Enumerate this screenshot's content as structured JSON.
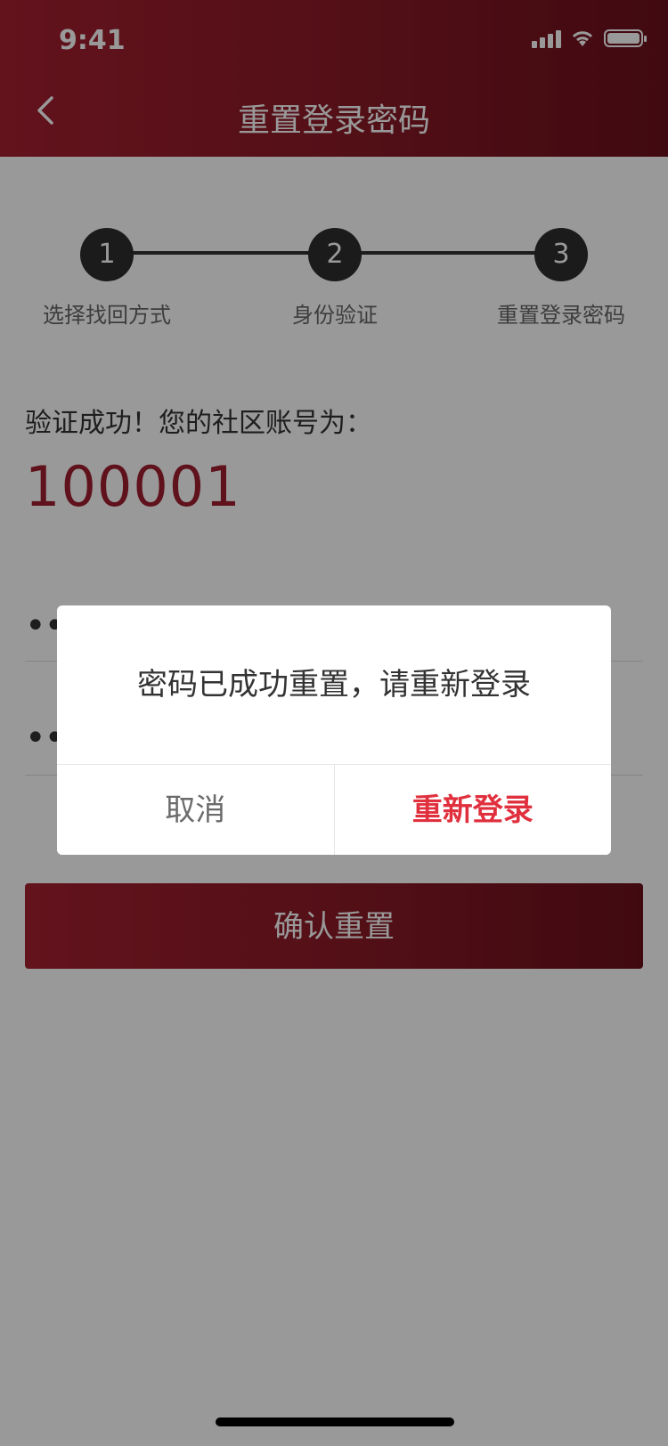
{
  "status_bar": {
    "time": "9:41"
  },
  "nav": {
    "title": "重置登录密码"
  },
  "steps": [
    {
      "number": "1",
      "label": "选择找回方式"
    },
    {
      "number": "2",
      "label": "身份验证"
    },
    {
      "number": "3",
      "label": "重置登录密码"
    }
  ],
  "result": {
    "message": "验证成功！您的社区账号为：",
    "account_number": "100001"
  },
  "form": {
    "new_password_value": "••",
    "confirm_password_value": "••",
    "confirm_button": "确认重置"
  },
  "dialog": {
    "message": "密码已成功重置，请重新登录",
    "cancel_label": "取消",
    "relogin_label": "重新登录"
  },
  "colors": {
    "brand_start": "#a52030",
    "brand_end": "#6c101c",
    "accent_text": "#a01f2f",
    "dialog_action": "#e0303e"
  },
  "icons": [
    "back-arrow-icon",
    "signal-icon",
    "wifi-icon",
    "battery-icon"
  ]
}
